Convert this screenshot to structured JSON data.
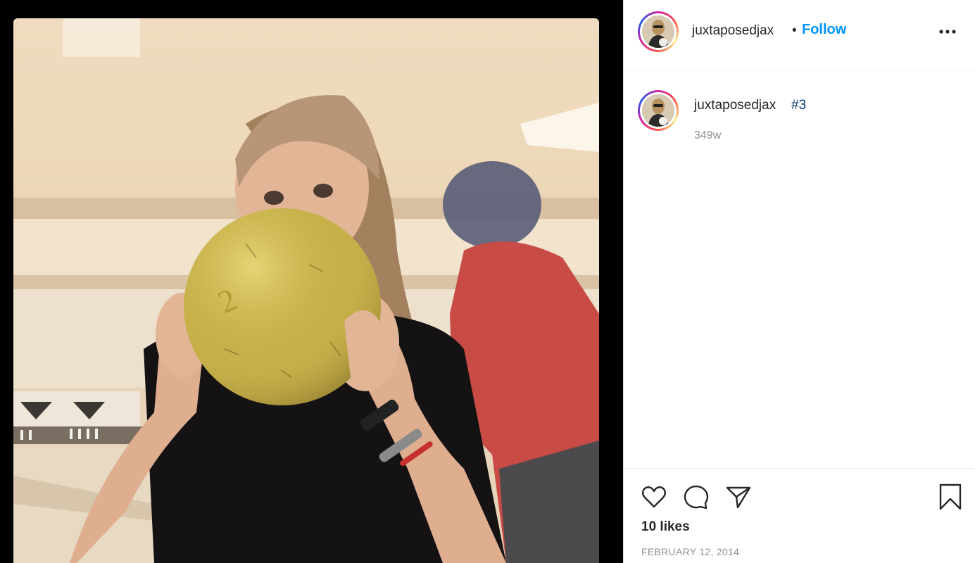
{
  "post": {
    "username": "juxtaposedjax",
    "follow_label": "Follow",
    "separator": "•",
    "caption_hashtag": "#3",
    "age": "349w",
    "likes": "10 likes",
    "date": "FEBRUARY 12, 2014"
  },
  "icons": {
    "more": "more-options-icon",
    "like": "heart-icon",
    "comment": "comment-bubble-icon",
    "share": "paper-plane-icon",
    "save": "bookmark-icon"
  },
  "colors": {
    "follow": "#0095f6",
    "hashtag": "#00376b",
    "muted": "#8e8e8e",
    "text": "#262626"
  }
}
